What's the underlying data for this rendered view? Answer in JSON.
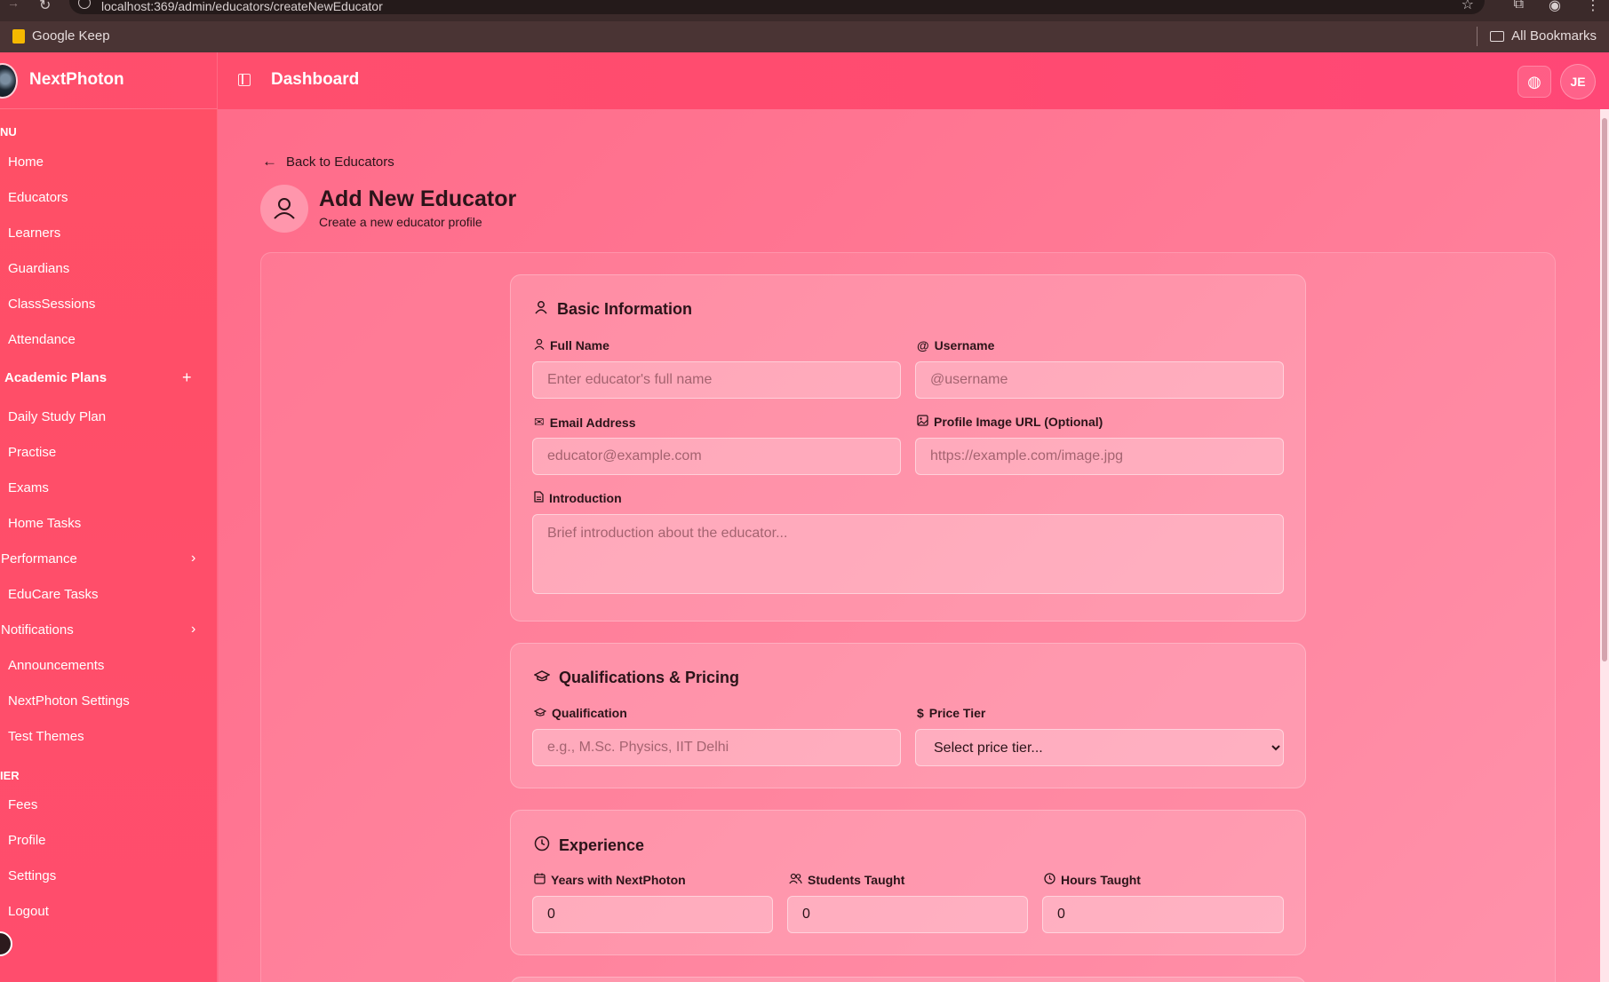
{
  "browser": {
    "url": "localhost:369/admin/educators/createNewEducator",
    "bookmark_keep": "Google Keep",
    "bookmark_all": "All Bookmarks"
  },
  "header": {
    "brand": "NextPhoton",
    "title": "Dashboard",
    "avatar_initials": "JE"
  },
  "sidebar": {
    "menu_label": "NU",
    "menu_items": [
      "Home",
      "Educators",
      "Learners",
      "Guardians",
      "ClassSessions",
      "Attendance"
    ],
    "academic_plans": "Academic Plans",
    "academic_items": [
      "Daily Study Plan",
      "Practise",
      "Exams",
      "Home Tasks"
    ],
    "performance": "Performance",
    "educare_tasks": "EduCare Tasks",
    "notifications": "Notifications",
    "announcements": "Announcements",
    "nextphoton_settings": "NextPhoton Settings",
    "test_themes": "Test Themes",
    "other_label": "IER",
    "other_items": [
      "Fees",
      "Profile",
      "Settings",
      "Logout"
    ]
  },
  "page": {
    "back_label": "Back to Educators",
    "title": "Add New Educator",
    "subtitle": "Create a new educator profile"
  },
  "basic": {
    "title": "Basic Information",
    "full_name_label": "Full Name",
    "full_name_placeholder": "Enter educator's full name",
    "username_label": "Username",
    "username_placeholder": "@username",
    "email_label": "Email Address",
    "email_placeholder": "educator@example.com",
    "image_label": "Profile Image URL (Optional)",
    "image_placeholder": "https://example.com/image.jpg",
    "intro_label": "Introduction",
    "intro_placeholder": "Brief introduction about the educator..."
  },
  "qualifications": {
    "title": "Qualifications & Pricing",
    "qualification_label": "Qualification",
    "qualification_placeholder": "e.g., M.Sc. Physics, IIT Delhi",
    "price_label": "Price Tier",
    "price_selected": "Select price tier..."
  },
  "experience": {
    "title": "Experience",
    "years_label": "Years with NextPhoton",
    "years_value": "0",
    "students_label": "Students Taught",
    "students_value": "0",
    "hours_label": "Hours Taught",
    "hours_value": "0"
  }
}
